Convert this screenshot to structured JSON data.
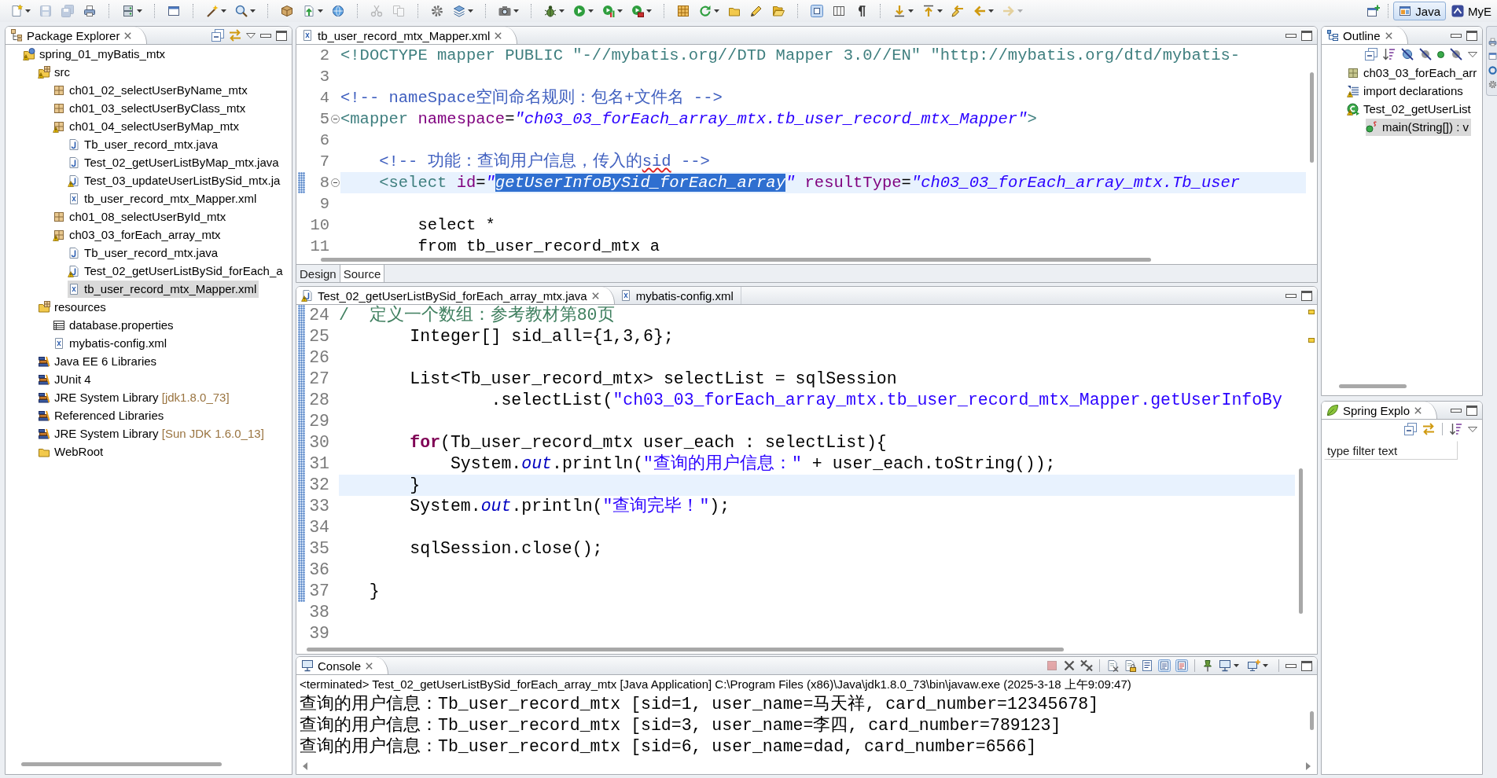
{
  "toolbar": {
    "groups": [
      [
        {
          "kind": "new",
          "menu": true,
          "disabled": false
        },
        {
          "kind": "save",
          "menu": false,
          "disabled": true
        },
        {
          "kind": "saveall",
          "menu": false,
          "disabled": true
        },
        {
          "kind": "print",
          "menu": false,
          "disabled": false
        }
      ],
      [
        {
          "kind": "server",
          "menu": true,
          "disabled": false
        }
      ],
      [
        {
          "kind": "window",
          "menu": false,
          "disabled": false
        }
      ],
      [
        {
          "kind": "wand",
          "menu": true,
          "disabled": false
        },
        {
          "kind": "search",
          "menu": true,
          "disabled": false
        }
      ],
      [
        {
          "kind": "box",
          "menu": false,
          "disabled": false
        },
        {
          "kind": "upload",
          "menu": true,
          "disabled": false
        },
        {
          "kind": "globe",
          "menu": false,
          "disabled": false
        }
      ],
      [
        {
          "kind": "scissors",
          "menu": false,
          "disabled": true
        },
        {
          "kind": "pages",
          "menu": false,
          "disabled": true
        }
      ],
      [
        {
          "kind": "gear",
          "menu": false,
          "disabled": false
        },
        {
          "kind": "layers",
          "menu": true,
          "disabled": false
        }
      ],
      [
        {
          "kind": "camera",
          "menu": true,
          "disabled": false
        }
      ],
      [
        {
          "kind": "bug",
          "menu": true,
          "disabled": false
        },
        {
          "kind": "run",
          "menu": true,
          "disabled": false
        },
        {
          "kind": "coverage",
          "menu": true,
          "disabled": false
        },
        {
          "kind": "tools",
          "menu": true,
          "disabled": false
        }
      ],
      [
        {
          "kind": "grid",
          "menu": false,
          "disabled": false
        },
        {
          "kind": "refresh",
          "menu": true,
          "disabled": false
        },
        {
          "kind": "folder",
          "menu": false,
          "disabled": false
        },
        {
          "kind": "pencil",
          "menu": false,
          "disabled": false
        },
        {
          "kind": "openfolder",
          "menu": false,
          "disabled": false
        }
      ],
      [
        {
          "kind": "blocks",
          "menu": false,
          "disabled": false
        },
        {
          "kind": "columns",
          "menu": false,
          "disabled": false
        },
        {
          "kind": "pilcrow",
          "menu": false,
          "disabled": false
        }
      ],
      [
        {
          "kind": "down",
          "menu": true,
          "disabled": false
        },
        {
          "kind": "up",
          "menu": true,
          "disabled": false
        },
        {
          "kind": "lastedit",
          "menu": false,
          "disabled": false
        },
        {
          "kind": "back",
          "menu": true,
          "disabled": false
        },
        {
          "kind": "forward",
          "menu": true,
          "disabled": true
        }
      ]
    ],
    "perspectives": [
      {
        "label": "Java",
        "selected": true
      },
      {
        "label": "MyE",
        "selected": false
      }
    ]
  },
  "package_explorer": {
    "title": "Package Explorer",
    "tree": [
      {
        "label": "spring_01_myBatis_mtx",
        "kind": "project",
        "warning": true,
        "selected": false,
        "children": [
          {
            "label": "src",
            "kind": "srcfolder",
            "warning": true,
            "selected": false,
            "children": [
              {
                "label": "ch01_02_selectUserByName_mtx",
                "kind": "package",
                "warning": false,
                "selected": false
              },
              {
                "label": "ch01_03_selectUserByClass_mtx",
                "kind": "package",
                "warning": false,
                "selected": false
              },
              {
                "label": "ch01_04_selectUserByMap_mtx",
                "kind": "package",
                "warning": true,
                "selected": false,
                "children": [
                  {
                    "label": "Tb_user_record_mtx.java",
                    "kind": "java",
                    "warning": false,
                    "selected": false
                  },
                  {
                    "label": "Test_02_getUserListByMap_mtx.java",
                    "kind": "java",
                    "warning": false,
                    "selected": false
                  },
                  {
                    "label": "Test_03_updateUserListBySid_mtx.ja",
                    "kind": "java",
                    "warning": true,
                    "selected": false
                  },
                  {
                    "label": "tb_user_record_mtx_Mapper.xml",
                    "kind": "xml",
                    "warning": false,
                    "selected": false
                  }
                ]
              },
              {
                "label": "ch01_08_selectUserById_mtx",
                "kind": "package",
                "warning": false,
                "selected": false
              },
              {
                "label": "ch03_03_forEach_array_mtx",
                "kind": "package",
                "warning": true,
                "selected": false,
                "children": [
                  {
                    "label": "Tb_user_record_mtx.java",
                    "kind": "java",
                    "warning": false,
                    "selected": false
                  },
                  {
                    "label": "Test_02_getUserListBySid_forEach_a",
                    "kind": "java",
                    "warning": true,
                    "selected": false
                  },
                  {
                    "label": "tb_user_record_mtx_Mapper.xml",
                    "kind": "xml",
                    "warning": false,
                    "selected": true
                  }
                ]
              }
            ]
          },
          {
            "label": "resources",
            "kind": "srcfolder",
            "warning": false,
            "selected": false,
            "children": [
              {
                "label": "database.properties",
                "kind": "properties",
                "warning": false,
                "selected": false
              },
              {
                "label": "mybatis-config.xml",
                "kind": "xml",
                "warning": false,
                "selected": false
              }
            ]
          },
          {
            "label": "Java EE 6 Libraries",
            "kind": "library",
            "warning": false,
            "selected": false
          },
          {
            "label": "JUnit 4",
            "kind": "library",
            "warning": false,
            "selected": false
          },
          {
            "label": "JRE System Library",
            "decoration": "[jdk1.8.0_73]",
            "kind": "library",
            "warning": false,
            "selected": false
          },
          {
            "label": "Referenced Libraries",
            "kind": "library",
            "warning": false,
            "selected": false
          },
          {
            "label": "JRE System Library",
            "decoration": "[Sun JDK 1.6.0_13]",
            "kind": "library",
            "warning": false,
            "selected": false
          },
          {
            "label": "WebRoot",
            "kind": "folder",
            "warning": false,
            "selected": false
          }
        ]
      }
    ]
  },
  "xml_editor": {
    "tabs": [
      {
        "label": "tb_user_record_mtx_Mapper.xml",
        "kind": "xml",
        "warning": false,
        "selected": true
      }
    ],
    "lines": [
      {
        "number": "2",
        "current": false,
        "range": false,
        "fold": false,
        "tokens": [
          {
            "kind": "doctype",
            "text": "<!DOCTYPE mapper PUBLIC \"-//mybatis.org//DTD Mapper 3.0//EN\" \"http://mybatis.org/dtd/mybatis-"
          }
        ]
      },
      {
        "number": "3",
        "current": false,
        "range": false,
        "fold": false
      },
      {
        "number": "4",
        "current": false,
        "range": false,
        "fold": false,
        "tokens": [
          {
            "kind": "comment",
            "text": "<!-- nameSpace空间命名规则：包名+文件名 -->"
          }
        ]
      },
      {
        "number": "5",
        "current": false,
        "range": false,
        "fold": true,
        "tokens": [
          {
            "kind": "tag",
            "text": "<mapper"
          },
          {
            "kind": "attr",
            "text": " namespace"
          },
          {
            "kind": "plain",
            "text": "="
          },
          {
            "kind": "value",
            "text": "\"ch03_03_forEach_array_mtx.tb_user_record_mtx_Mapper\""
          },
          {
            "kind": "tag",
            "text": ">"
          }
        ]
      },
      {
        "number": "6",
        "current": false,
        "range": false,
        "fold": false
      },
      {
        "number": "7",
        "current": false,
        "range": false,
        "fold": false,
        "tokens": [
          {
            "kind": "comment",
            "text": "    <!-- 功能：查询用户信息，传入的"
          },
          {
            "kind": "misspelled",
            "text": "sid"
          },
          {
            "kind": "comment",
            "text": " -->"
          }
        ]
      },
      {
        "number": "8",
        "current": true,
        "range": true,
        "fold": true,
        "tokens": [
          {
            "kind": "tag",
            "text": "    <select"
          },
          {
            "kind": "attr",
            "text": " id"
          },
          {
            "kind": "plain",
            "text": "="
          },
          {
            "kind": "value",
            "text": "\""
          },
          {
            "kind": "selection",
            "text": "getUserInfoBySid_forEach_array"
          },
          {
            "kind": "value",
            "text": "\""
          },
          {
            "kind": "attr",
            "text": " resultType"
          },
          {
            "kind": "plain",
            "text": "="
          },
          {
            "kind": "value",
            "text": "\"ch03_03_forEach_array_mtx.Tb_user"
          }
        ]
      },
      {
        "number": "9",
        "current": false,
        "range": false,
        "fold": false
      },
      {
        "number": "10",
        "current": false,
        "range": false,
        "fold": false,
        "tokens": [
          {
            "kind": "plain",
            "text": "        select *"
          }
        ]
      },
      {
        "number": "11",
        "current": false,
        "range": false,
        "fold": false,
        "tokens": [
          {
            "kind": "plain",
            "text": "        from tb_user_record_mtx a"
          }
        ]
      }
    ],
    "mode_tabs": [
      {
        "label": "Design",
        "selected": false
      },
      {
        "label": "Source",
        "selected": true
      }
    ]
  },
  "java_editor": {
    "tabs": [
      {
        "label": "Test_02_getUserListBySid_forEach_array_mtx.java",
        "kind": "java",
        "warning": true,
        "selected": true
      },
      {
        "label": "mybatis-config.xml",
        "kind": "xml",
        "warning": false,
        "selected": false
      }
    ],
    "lines": [
      {
        "number": "24",
        "current": false,
        "range": true,
        "tokens": [
          {
            "kind": "comment",
            "text": "/  定义一个数组：参考教材第80页"
          }
        ]
      },
      {
        "number": "25",
        "current": false,
        "range": true,
        "tokens": [
          {
            "kind": "plain",
            "text": "       Integer[] sid_all={1,3,6};"
          }
        ]
      },
      {
        "number": "26",
        "current": false,
        "range": true
      },
      {
        "number": "27",
        "current": false,
        "range": true,
        "tokens": [
          {
            "kind": "plain",
            "text": "       List<Tb_user_record_mtx> selectList = sqlSession"
          }
        ]
      },
      {
        "number": "28",
        "current": false,
        "range": true,
        "tokens": [
          {
            "kind": "plain",
            "text": "               .selectList("
          },
          {
            "kind": "string",
            "text": "\"ch03_03_forEach_array_mtx.tb_user_record_mtx_Mapper.getUserInfoBy"
          }
        ]
      },
      {
        "number": "29",
        "current": false,
        "range": true
      },
      {
        "number": "30",
        "current": false,
        "range": true,
        "tokens": [
          {
            "kind": "keyword",
            "text": "       for"
          },
          {
            "kind": "plain",
            "text": "(Tb_user_record_mtx user_each : selectList){"
          }
        ]
      },
      {
        "number": "31",
        "current": false,
        "range": true,
        "tokens": [
          {
            "kind": "plain",
            "text": "           System."
          },
          {
            "kind": "field",
            "text": "out"
          },
          {
            "kind": "plain",
            "text": ".println("
          },
          {
            "kind": "string",
            "text": "\"查询的用户信息：\""
          },
          {
            "kind": "plain",
            "text": " + user_each.toString());"
          }
        ]
      },
      {
        "number": "32",
        "current": true,
        "range": true,
        "tokens": [
          {
            "kind": "plain",
            "text": "       }"
          }
        ]
      },
      {
        "number": "33",
        "current": false,
        "range": true,
        "tokens": [
          {
            "kind": "plain",
            "text": "       System."
          },
          {
            "kind": "field",
            "text": "out"
          },
          {
            "kind": "plain",
            "text": ".println("
          },
          {
            "kind": "string",
            "text": "\"查询完毕！\""
          },
          {
            "kind": "plain",
            "text": ");"
          }
        ]
      },
      {
        "number": "34",
        "current": false,
        "range": true
      },
      {
        "number": "35",
        "current": false,
        "range": true,
        "tokens": [
          {
            "kind": "plain",
            "text": "       sqlSession.close();"
          }
        ]
      },
      {
        "number": "36",
        "current": false,
        "range": true
      },
      {
        "number": "37",
        "current": false,
        "range": true,
        "tokens": [
          {
            "kind": "plain",
            "text": "   }"
          }
        ]
      },
      {
        "number": "38",
        "current": false,
        "range": false
      },
      {
        "number": "39",
        "current": false,
        "range": false
      }
    ]
  },
  "console": {
    "title": "Console",
    "buttons": [
      [
        {
          "kind": "stop",
          "menu": false,
          "disabled": true
        },
        {
          "kind": "cross",
          "menu": false,
          "disabled": false
        },
        {
          "kind": "doublecross",
          "menu": false,
          "disabled": false
        }
      ],
      [
        {
          "kind": "clearpage",
          "menu": false,
          "disabled": false
        },
        {
          "kind": "lockpage",
          "menu": false,
          "disabled": false
        },
        {
          "kind": "pagelines",
          "menu": false,
          "disabled": false
        },
        {
          "kind": "outpage",
          "menu": false,
          "disabled": false
        },
        {
          "kind": "errpage",
          "menu": false,
          "disabled": false
        }
      ],
      [
        {
          "kind": "pin",
          "menu": false,
          "disabled": false
        },
        {
          "kind": "monitor",
          "menu": true,
          "disabled": false
        },
        {
          "kind": "monitorplus",
          "menu": true,
          "disabled": false
        }
      ]
    ],
    "status": "<terminated> Test_02_getUserListBySid_forEach_array_mtx [Java Application] C:\\Program Files (x86)\\Java\\jdk1.8.0_73\\bin\\javaw.exe (2025-3-18 上午9:09:47)",
    "output": [
      "查询的用户信息：Tb_user_record_mtx [sid=1, user_name=马天祥, card_number=12345678]",
      "查询的用户信息：Tb_user_record_mtx [sid=3, user_name=李四, card_number=789123]",
      "查询的用户信息：Tb_user_record_mtx [sid=6, user_name=dad, card_number=6566]"
    ]
  },
  "outline": {
    "title": "Outline",
    "tree": [
      {
        "label": "ch03_03_forEach_arr",
        "kind": "pkgdecl",
        "warning": false,
        "selected": false
      },
      {
        "label": "import declarations",
        "kind": "imports",
        "warning": true,
        "selected": false
      },
      {
        "label": "Test_02_getUserList",
        "kind": "class",
        "warning": true,
        "selected": false,
        "children": [
          {
            "label": "main(String[]) : v",
            "kind": "method",
            "warning": false,
            "selected": true
          }
        ]
      }
    ]
  },
  "spring_explorer": {
    "title": "Spring Explo",
    "filter": {
      "placeholder": "type filter text"
    }
  }
}
